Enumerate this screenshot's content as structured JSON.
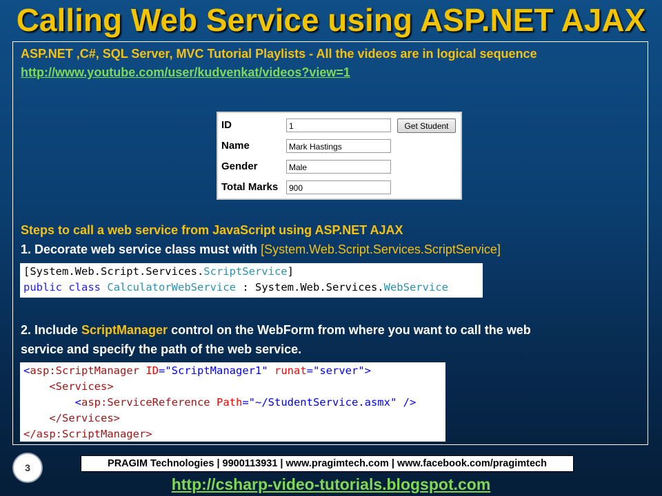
{
  "slide": {
    "title": "Calling Web Service using ASP.NET AJAX",
    "page_number": "3"
  },
  "intro": {
    "playlist_text": "ASP.NET ,C#, SQL Server, MVC Tutorial Playlists - All the videos are in logical sequence",
    "youtube_link": "http://www.youtube.com/user/kudvenkat/videos?view=1"
  },
  "student_form": {
    "id_label": "ID",
    "id_value": "1",
    "get_button": "Get Student",
    "name_label": "Name",
    "name_value": "Mark Hastings",
    "gender_label": "Gender",
    "gender_value": "Male",
    "marks_label": "Total Marks",
    "marks_value": "900"
  },
  "steps": {
    "heading": "Steps to call a web service from JavaScript using ASP.NET AJAX",
    "step1_prefix": "1. Decorate web service class must with ",
    "step1_attr": "[System.Web.Script.Services.ScriptService]",
    "step2_prefix": "2. Include ",
    "step2_highlight": "ScriptManager",
    "step2_suffix": " control on the WebForm from where you want to call the web",
    "step2_line2": "service and specify the path of the web service."
  },
  "code1": {
    "l1_a": "[System.Web.Script.Services.",
    "l1_b": "ScriptService",
    "l1_c": "]",
    "l2_kw1": "public",
    "l2_kw2": "class",
    "l2_type": "CalculatorWebService",
    "l2_mid": " : System.Web.Services.",
    "l2_base": "WebService"
  },
  "code2": {
    "lt": "<",
    "gt": ">",
    "sm_tag": "asp:ScriptManager",
    "id_attr": "ID",
    "id_val": "\"ScriptManager1\"",
    "runat_attr": "runat",
    "runat_val": "\"server\"",
    "services_open": "<Services>",
    "sr_tag": "asp:ServiceReference",
    "path_attr": "Path",
    "path_val": "\"~/StudentService.asmx\"",
    "self_close": "/>",
    "services_close": "</Services>",
    "sm_close": "</asp:ScriptManager>",
    "eq": "="
  },
  "footer": {
    "contact": "PRAGIM Technologies | 9900113931 | www.pragimtech.com | www.facebook.com/pragimtech",
    "blog_link": "http://csharp-video-tutorials.blogspot.com"
  },
  "colors": {
    "title": "#f2c400",
    "highlight": "#f6c10f",
    "link": "#7ed957",
    "background": "#0b3f72"
  }
}
